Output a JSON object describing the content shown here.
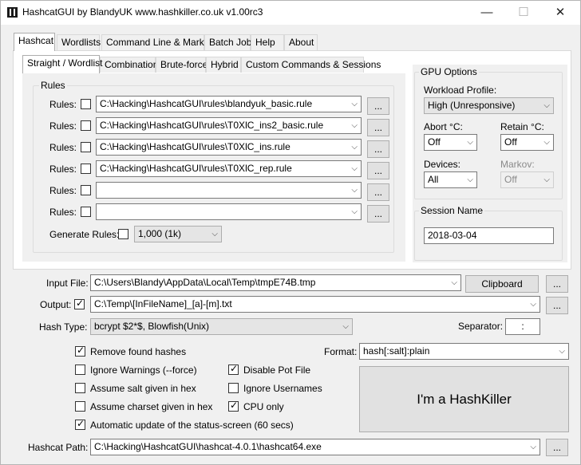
{
  "window": {
    "title": "HashcatGUI by BlandyUK www.hashkiller.co.uk v1.00rc3",
    "minimize": "—",
    "maximize": "☐",
    "close": "✕"
  },
  "main_tabs": [
    "Hashcat",
    "Wordlists",
    "Command Line & Markov",
    "Batch Job",
    "Help",
    "About"
  ],
  "sub_tabs": [
    "Straight / Wordlist",
    "Combination",
    "Brute-force",
    "Hybrid",
    "Custom Commands & Sessions"
  ],
  "rules": {
    "group_title": "Rules",
    "row_label": "Rules:",
    "browse_label": "...",
    "rows": [
      {
        "checked": false,
        "value": "C:\\Hacking\\HashcatGUI\\rules\\blandyuk_basic.rule"
      },
      {
        "checked": false,
        "value": "C:\\Hacking\\HashcatGUI\\rules\\T0XlC_ins2_basic.rule"
      },
      {
        "checked": false,
        "value": "C:\\Hacking\\HashcatGUI\\rules\\T0XlC_ins.rule"
      },
      {
        "checked": false,
        "value": "C:\\Hacking\\HashcatGUI\\rules\\T0XlC_rep.rule"
      },
      {
        "checked": false,
        "value": ""
      },
      {
        "checked": false,
        "value": ""
      }
    ],
    "generate_label": "Generate Rules:",
    "generate_checked": false,
    "generate_value": "1,000 (1k)"
  },
  "gpu": {
    "group_title": "GPU Options",
    "workload_label": "Workload Profile:",
    "workload_value": "High (Unresponsive)",
    "abort_label": "Abort °C:",
    "abort_value": "Off",
    "retain_label": "Retain °C:",
    "retain_value": "Off",
    "devices_label": "Devices:",
    "devices_value": "All",
    "markov_label": "Markov:",
    "markov_value": "Off"
  },
  "session": {
    "group_title": "Session Name",
    "value": "2018-03-04"
  },
  "input_file": {
    "label": "Input File:",
    "value": "C:\\Users\\Blandy\\AppData\\Local\\Temp\\tmpE74B.tmp",
    "clipboard_label": "Clipboard",
    "browse_label": "..."
  },
  "output": {
    "label": "Output:",
    "checked": true,
    "value": "C:\\Temp\\[InFileName]_[a]-[m].txt",
    "browse_label": "..."
  },
  "hash_type": {
    "label": "Hash Type:",
    "value": "bcrypt $2*$, Blowfish(Unix)",
    "separator_label": "Separator:",
    "separator_value": ":"
  },
  "options": {
    "format_label": "Format:",
    "format_value": "hash[:salt]:plain",
    "items": [
      {
        "key": "remove-found-hashes",
        "label": "Remove found hashes",
        "checked": true
      },
      {
        "key": "ignore-warnings",
        "label": "Ignore Warnings (--force)",
        "checked": false
      },
      {
        "key": "disable-pot-file",
        "label": "Disable Pot File",
        "checked": true
      },
      {
        "key": "assume-salt-hex",
        "label": "Assume salt given in hex",
        "checked": false
      },
      {
        "key": "ignore-usernames",
        "label": "Ignore Usernames",
        "checked": false
      },
      {
        "key": "assume-charset-hex",
        "label": "Assume charset given in hex",
        "checked": false
      },
      {
        "key": "cpu-only",
        "label": "CPU only",
        "checked": true
      },
      {
        "key": "auto-update-status",
        "label": "Automatic update of the status-screen (60 secs)",
        "checked": true
      }
    ],
    "start_button_label": "I'm a HashKiller"
  },
  "hashcat_path": {
    "label": "Hashcat Path:",
    "value": "C:\\Hacking\\HashcatGUI\\hashcat-4.0.1\\hashcat64.exe",
    "browse_label": "..."
  }
}
